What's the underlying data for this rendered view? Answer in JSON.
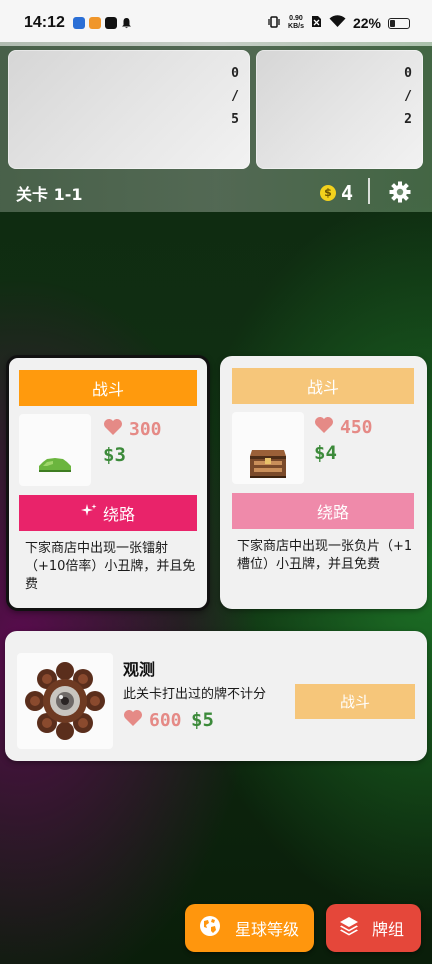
{
  "status_bar": {
    "time": "14:12",
    "net_speed_value": "0.90",
    "net_speed_unit": "KB/s",
    "battery": "22%"
  },
  "top_panel": {
    "slot1_count": [
      "0",
      "/",
      "5"
    ],
    "slot2_count": [
      "0",
      "/",
      "2"
    ],
    "level": "关卡 1-1",
    "coin_symbol": "$",
    "gold": "4"
  },
  "cards": [
    {
      "fight_label": "战斗",
      "hp": "300",
      "price": "$3",
      "detour_label": "绕路",
      "description": "下家商店中出现一张镭射（+10倍率）小丑牌，并且免费",
      "monster_icon": "green-slime-icon",
      "selected": true
    },
    {
      "fight_label": "战斗",
      "hp": "450",
      "price": "$4",
      "detour_label": "绕路",
      "description": "下家商店中出现一张负片（+1槽位）小丑牌，并且免费",
      "monster_icon": "treasure-chest-mimic-icon",
      "selected": false
    }
  ],
  "boss": {
    "name": "观测",
    "description": "此关卡打出过的牌不计分",
    "hp": "600",
    "price": "$5",
    "fight_label": "战斗",
    "monster_icon": "eye-boss-icon"
  },
  "bottom": {
    "planet_label": "星球等级",
    "deck_label": "牌组"
  },
  "colors": {
    "fight": "#ff9a0d",
    "fight_dim": "#f6c67a",
    "detour": "#e9236a",
    "detour_dim": "#ef8aaa",
    "hp": "#e58a86",
    "price": "#3c8a3a",
    "planet_button": "#ff960d",
    "deck_button": "#e5473a"
  }
}
